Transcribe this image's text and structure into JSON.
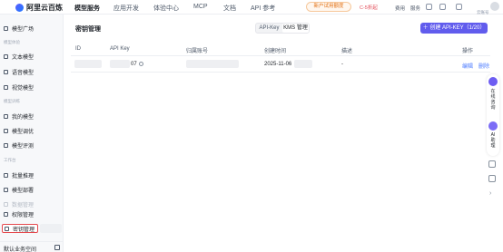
{
  "topbar": {
    "brand": "阿里云百炼",
    "nav": [
      "模型服务",
      "应用开发",
      "体验中心",
      "MCP",
      "文档",
      "API 参考"
    ],
    "promo": "新户试用额度",
    "promo2": "C-5折起",
    "links": [
      "费用",
      "服务"
    ],
    "user_label": "云账号"
  },
  "sidebar": {
    "groups": [
      "模型体验",
      "模型训练",
      "工作台"
    ],
    "items": [
      "模型广场",
      "文本模型",
      "语音模型",
      "视觉模型",
      "我的模型",
      "模型调优",
      "模型评测",
      "批量推理",
      "模型部署",
      "数据管理",
      "权限管理",
      "密钥管理"
    ],
    "bottom_label": "默认业务空间"
  },
  "main": {
    "title": "密钥管理",
    "tabs": [
      "API-Key",
      "KMS 管理"
    ],
    "create_button": "＋  创建 API-KEY（1/20）",
    "columns": [
      "ID",
      "API Key",
      "归属账号",
      "创建时间",
      "描述",
      "操作"
    ],
    "rows": [
      {
        "key_suffix": "07",
        "created": "2025-11-06",
        "description": "-",
        "actions": [
          "编辑",
          "删除"
        ]
      }
    ]
  },
  "rail": {
    "help_text": [
      "在",
      "线",
      "咨",
      "询"
    ],
    "ai_text": [
      "AI",
      "助",
      "理"
    ]
  },
  "colors": {
    "accent": "#615ced",
    "link": "#4d7cff",
    "highlight": "#e5484d"
  }
}
